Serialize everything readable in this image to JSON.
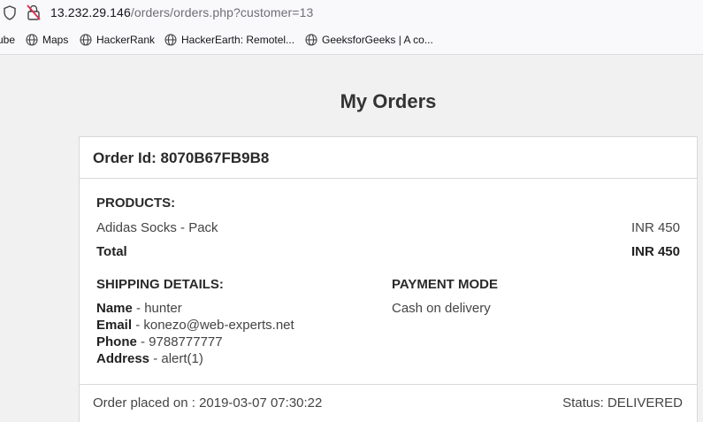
{
  "browser": {
    "url_host": "13.232.29.146",
    "url_path": "/orders/orders.php?customer=13",
    "bookmarks": [
      {
        "label": "ube"
      },
      {
        "label": "Maps"
      },
      {
        "label": "HackerRank"
      },
      {
        "label": "HackerEarth: Remotel..."
      },
      {
        "label": "GeeksforGeeks | A co..."
      }
    ]
  },
  "page": {
    "title": "My Orders"
  },
  "order": {
    "id_label": "Order Id: 8070B67FB9B8",
    "products_heading": "PRODUCTS:",
    "product_name": "Adidas Socks - Pack",
    "product_price": "INR 450",
    "total_label": "Total",
    "total_value": "INR 450",
    "shipping_heading": "SHIPPING DETAILS:",
    "name_label": "Name",
    "name_value": " - hunter",
    "email_label": "Email",
    "email_value": " - konezo@web-experts.net",
    "phone_label": "Phone",
    "phone_value": " - 9788777777",
    "address_label": "Address",
    "address_value": " - alert(1)",
    "payment_heading": "PAYMENT MODE",
    "payment_value": "Cash on delivery",
    "placed_on": "Order placed on : 2019-03-07 07:30:22",
    "status": "Status: DELIVERED"
  }
}
